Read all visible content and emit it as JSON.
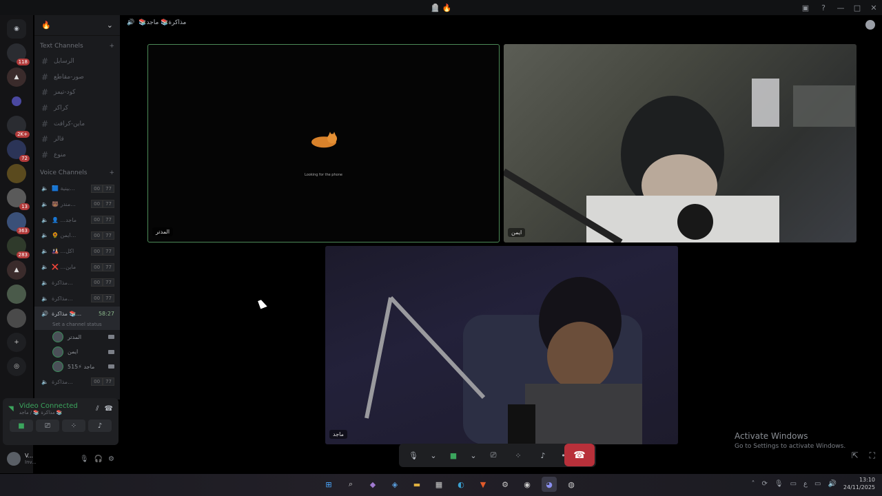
{
  "titlebar": {
    "title": "🪦 🔥",
    "help": "?"
  },
  "servers": [
    {
      "badge": "118"
    },
    {
      "badge": ""
    },
    {
      "badge": ""
    },
    {
      "badge": "2K+"
    },
    {
      "badge": "72"
    },
    {
      "badge": ""
    },
    {
      "badge": "13"
    },
    {
      "badge": "363"
    },
    {
      "badge": "283"
    },
    {
      "badge": ""
    },
    {
      "badge": ""
    },
    {
      "badge": ""
    }
  ],
  "sidebar": {
    "server_name": "🔥",
    "text_category": "Text Channels",
    "text_channels": [
      "الرسايل",
      "صور-مقاطع",
      "كود-تيمز",
      "كراكر",
      "ماين-كرافت",
      "قالر",
      "منوع"
    ],
    "voice_category": "Voice Channels",
    "voice_channels": [
      {
        "name": "🟦 بينية...",
        "a": "00",
        "b": "77"
      },
      {
        "name": "🐻 مندر...",
        "a": "00",
        "b": "77"
      },
      {
        "name": "👤 ...ماجد",
        "a": "00",
        "b": "77"
      },
      {
        "name": "🌻 ايمن...",
        "a": "00",
        "b": "77"
      },
      {
        "name": "🎎 ...اكل",
        "a": "00",
        "b": "77"
      },
      {
        "name": "❌ ...ماين",
        "a": "00",
        "b": "77"
      },
      {
        "name": "مذاكرة...",
        "a": "00",
        "b": "77"
      },
      {
        "name": "مذاكرة...",
        "a": "00",
        "b": "77"
      }
    ],
    "active_channel": {
      "name": "مذاكرة 📚...",
      "timer": "58:27",
      "status": "Set a channel status"
    },
    "members": [
      {
        "name": "المدتر"
      },
      {
        "name": "ايمن"
      },
      {
        "name": "ماجد ⚡515"
      }
    ],
    "after_channel": {
      "name": "مذاكرة...",
      "a": "00",
      "b": "77"
    }
  },
  "voice_panel": {
    "title": "Video Connected",
    "subtitle": "مذاكرة 📚 / ماجد 📚"
  },
  "user_panel": {
    "name": "V...",
    "status": "Inv..."
  },
  "main": {
    "channel_title": "📚مذاكرة📚 ماجد",
    "tiles": [
      {
        "label": "المدتر",
        "loading_text": "Looking for the phone"
      },
      {
        "label": "ايمن"
      },
      {
        "label": "ماجد"
      }
    ]
  },
  "activate": {
    "line1": "Activate Windows",
    "line2": "Go to Settings to activate Windows."
  },
  "taskbar": {
    "lang": "ع",
    "time": "13:10",
    "date": "24/11/2025"
  }
}
